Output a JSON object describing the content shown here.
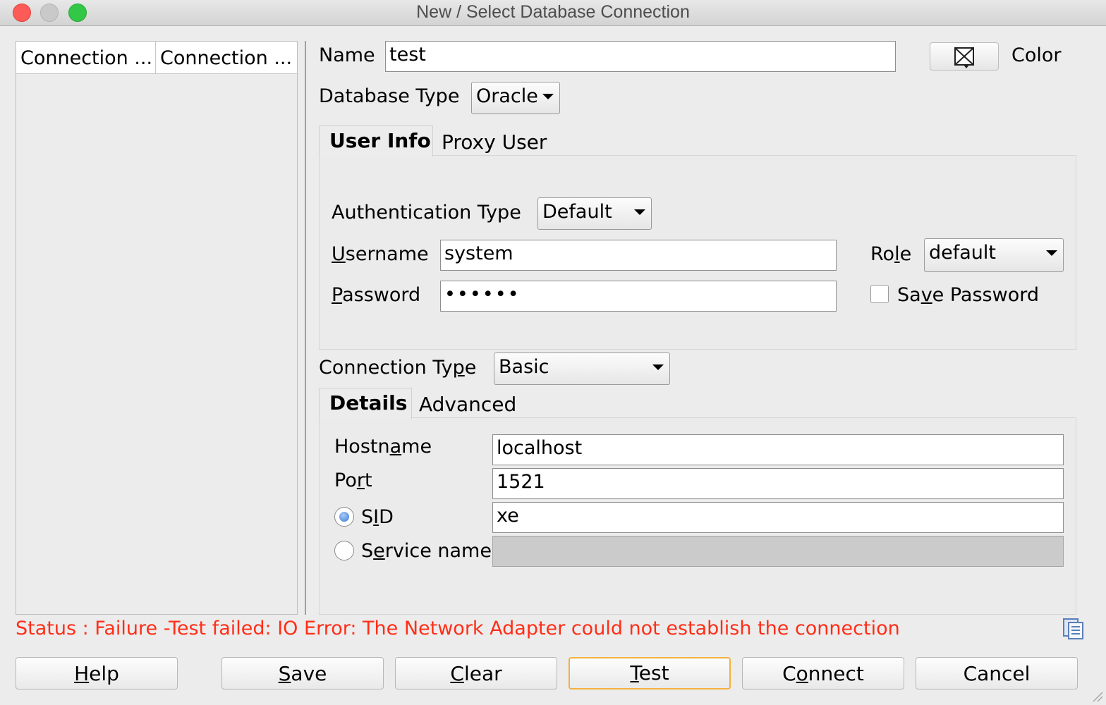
{
  "window": {
    "title": "New / Select Database Connection"
  },
  "connections_list": {
    "columns": [
      "Connection ...",
      "Connection ..."
    ]
  },
  "form": {
    "name_label": "Name",
    "name_value": "test",
    "color_label": "Color",
    "db_type_label": "Database Type",
    "db_type_value": "Oracle",
    "tabs_top": [
      "User Info",
      "Proxy User"
    ],
    "auth_type_label": "Authentication Type",
    "auth_type_value": "Default",
    "username_label": "Username",
    "username_value": "system",
    "password_label": "Password",
    "password_value": "••••••",
    "role_label": "Role",
    "role_value": "default",
    "save_password_label": "Save Password",
    "save_password_checked": false,
    "conn_type_label": "Connection Type",
    "conn_type_value": "Basic",
    "tabs_bottom": [
      "Details",
      "Advanced"
    ],
    "hostname_label": "Hostname",
    "hostname_value": "localhost",
    "port_label": "Port",
    "port_value": "1521",
    "sid_label": "SID",
    "sid_value": "xe",
    "sid_selected": true,
    "service_name_label": "Service name",
    "service_name_value": ""
  },
  "status": {
    "text": "Status : Failure -Test failed: IO Error: The Network Adapter could not establish the connection",
    "color": "#ff2e18"
  },
  "buttons": {
    "help": "Help",
    "save": "Save",
    "clear": "Clear",
    "test": "Test",
    "connect": "Connect",
    "cancel": "Cancel"
  }
}
